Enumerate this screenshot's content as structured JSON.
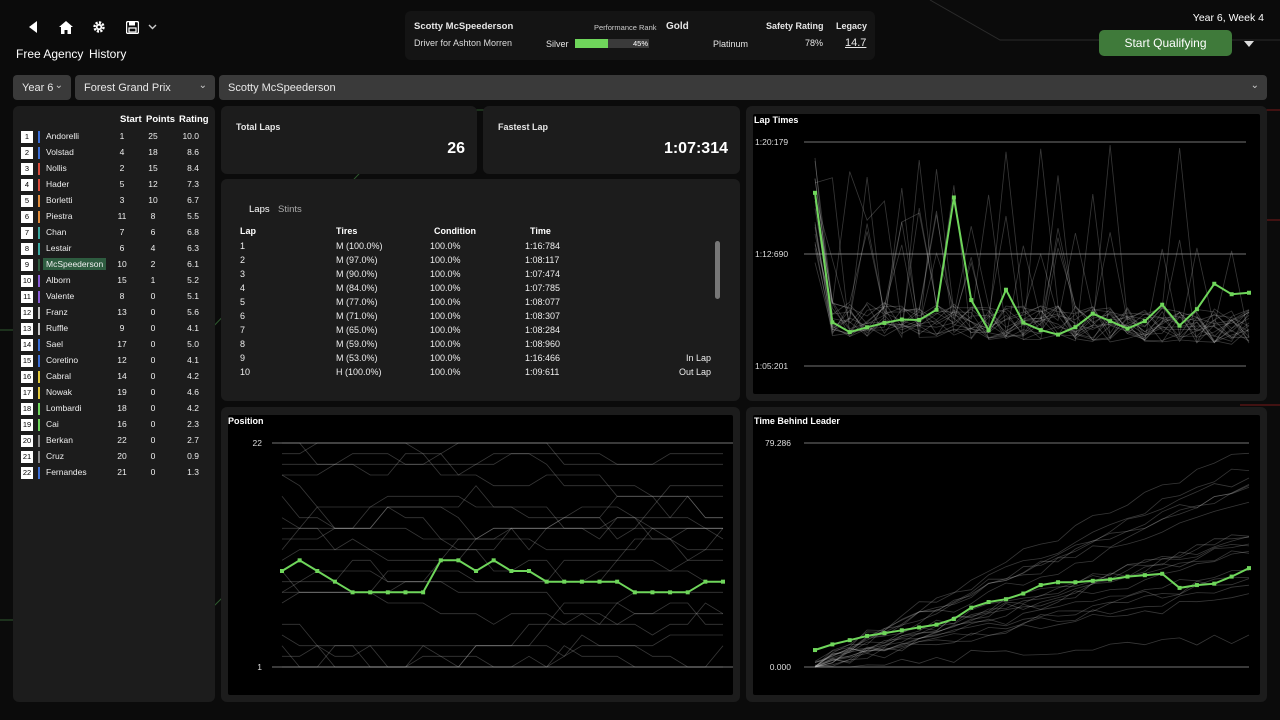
{
  "colors": {
    "accent": "#6fd65b",
    "button_green": "#3f7a3a",
    "panel": "#1c1c1c"
  },
  "topbar": {
    "icons": [
      "back-icon",
      "home-icon",
      "gear-icon",
      "save-icon",
      "chevron-down-icon"
    ],
    "nav": {
      "free_agency": "Free Agency",
      "history": "History"
    },
    "driver_name": "Scotty McSpeederson",
    "driver_for": "Driver for Ashton Morren",
    "performance_rank_label": "Performance Rank",
    "performance_rank_value": "Gold",
    "progress_left": "Silver",
    "progress_right": "Platinum",
    "progress_pct_text": "45%",
    "progress_value": 0.45,
    "safety_label": "Safety Rating",
    "safety_value": "78%",
    "legacy_label": "Legacy",
    "legacy_value": "14.7",
    "date": "Year 6, Week 4",
    "start_button": "Start Qualifying"
  },
  "filters": {
    "year": "Year 6",
    "race": "Forest Grand Prix",
    "driver": "Scotty McSpeederson"
  },
  "standings": {
    "headers": {
      "start": "Start",
      "points": "Points",
      "rating": "Rating"
    },
    "rows": [
      {
        "pos": "1",
        "name": "Andorelli",
        "start": "1",
        "points": "25",
        "rating": "10.0",
        "color": "#3a6ed8"
      },
      {
        "pos": "2",
        "name": "Volstad",
        "start": "4",
        "points": "18",
        "rating": "8.6",
        "color": "#3a6ed8"
      },
      {
        "pos": "3",
        "name": "Nollis",
        "start": "2",
        "points": "15",
        "rating": "8.4",
        "color": "#d84a3a"
      },
      {
        "pos": "4",
        "name": "Hader",
        "start": "5",
        "points": "12",
        "rating": "7.3",
        "color": "#d84a3a"
      },
      {
        "pos": "5",
        "name": "Borletti",
        "start": "3",
        "points": "10",
        "rating": "6.7",
        "color": "#e08a3a"
      },
      {
        "pos": "6",
        "name": "Piestra",
        "start": "11",
        "points": "8",
        "rating": "5.5",
        "color": "#e08a3a"
      },
      {
        "pos": "7",
        "name": "Chan",
        "start": "7",
        "points": "6",
        "rating": "6.8",
        "color": "#3aa8a0"
      },
      {
        "pos": "8",
        "name": "Lestair",
        "start": "6",
        "points": "4",
        "rating": "6.3",
        "color": "#3aa8a0"
      },
      {
        "pos": "9",
        "name": "McSpeederson",
        "start": "10",
        "points": "2",
        "rating": "6.1",
        "color": "#2e5c40"
      },
      {
        "pos": "10",
        "name": "Alborn",
        "start": "15",
        "points": "1",
        "rating": "5.2",
        "color": "#8a5ad8"
      },
      {
        "pos": "11",
        "name": "Valente",
        "start": "8",
        "points": "0",
        "rating": "5.1",
        "color": "#8a5ad8"
      },
      {
        "pos": "12",
        "name": "Franz",
        "start": "13",
        "points": "0",
        "rating": "5.6",
        "color": "#c8c8c8"
      },
      {
        "pos": "13",
        "name": "Ruffle",
        "start": "9",
        "points": "0",
        "rating": "4.1",
        "color": "#c8c8c8"
      },
      {
        "pos": "14",
        "name": "Sael",
        "start": "17",
        "points": "0",
        "rating": "5.0",
        "color": "#3a6ed8"
      },
      {
        "pos": "15",
        "name": "Coretino",
        "start": "12",
        "points": "0",
        "rating": "4.1",
        "color": "#3a6ed8"
      },
      {
        "pos": "16",
        "name": "Cabral",
        "start": "14",
        "points": "0",
        "rating": "4.2",
        "color": "#e0c83a"
      },
      {
        "pos": "17",
        "name": "Nowak",
        "start": "19",
        "points": "0",
        "rating": "4.6",
        "color": "#e0c83a"
      },
      {
        "pos": "18",
        "name": "Lombardi",
        "start": "18",
        "points": "0",
        "rating": "4.2",
        "color": "#6fd65b"
      },
      {
        "pos": "19",
        "name": "Cai",
        "start": "16",
        "points": "0",
        "rating": "2.3",
        "color": "#6fd65b"
      },
      {
        "pos": "20",
        "name": "Berkan",
        "start": "22",
        "points": "0",
        "rating": "2.7",
        "color": "#888888"
      },
      {
        "pos": "21",
        "name": "Cruz",
        "start": "20",
        "points": "0",
        "rating": "0.9",
        "color": "#888888"
      },
      {
        "pos": "22",
        "name": "Fernandes",
        "start": "21",
        "points": "0",
        "rating": "1.3",
        "color": "#3a6ed8"
      }
    ]
  },
  "stats": {
    "total_laps_label": "Total Laps",
    "total_laps": "26",
    "fastest_lap_label": "Fastest Lap",
    "fastest_lap": "1:07:314"
  },
  "laps": {
    "tabs": [
      "Laps",
      "Stints"
    ],
    "headers": {
      "lap": "Lap",
      "tires": "Tires",
      "condition": "Condition",
      "time": "Time"
    },
    "rows": [
      {
        "lap": "1",
        "tires": "M (100.0%)",
        "condition": "100.0%",
        "time": "1:16:784",
        "note": ""
      },
      {
        "lap": "2",
        "tires": "M (97.0%)",
        "condition": "100.0%",
        "time": "1:08:117",
        "note": ""
      },
      {
        "lap": "3",
        "tires": "M (90.0%)",
        "condition": "100.0%",
        "time": "1:07:474",
        "note": ""
      },
      {
        "lap": "4",
        "tires": "M (84.0%)",
        "condition": "100.0%",
        "time": "1:07:785",
        "note": ""
      },
      {
        "lap": "5",
        "tires": "M (77.0%)",
        "condition": "100.0%",
        "time": "1:08:077",
        "note": ""
      },
      {
        "lap": "6",
        "tires": "M (71.0%)",
        "condition": "100.0%",
        "time": "1:08:307",
        "note": ""
      },
      {
        "lap": "7",
        "tires": "M (65.0%)",
        "condition": "100.0%",
        "time": "1:08:284",
        "note": ""
      },
      {
        "lap": "8",
        "tires": "M (59.0%)",
        "condition": "100.0%",
        "time": "1:08:960",
        "note": ""
      },
      {
        "lap": "9",
        "tires": "M (53.0%)",
        "condition": "100.0%",
        "time": "1:16:466",
        "note": "In Lap"
      },
      {
        "lap": "10",
        "tires": "H (100.0%)",
        "condition": "100.0%",
        "time": "1:09:611",
        "note": "Out Lap"
      }
    ]
  },
  "chart_data": [
    {
      "type": "line",
      "title": "Lap Times",
      "ytick_labels": [
        "1:20:179",
        "1:12:690",
        "1:05:201"
      ],
      "ylim": [
        65.201,
        80.179
      ],
      "x": [
        1,
        2,
        3,
        4,
        5,
        6,
        7,
        8,
        9,
        10,
        11,
        12,
        13,
        14,
        15,
        16,
        17,
        18,
        19,
        20,
        21,
        22,
        23,
        24,
        25,
        26
      ],
      "series": [
        {
          "values": [
            76.78,
            68.12,
            67.47,
            67.79,
            68.08,
            68.31,
            68.28,
            68.96,
            76.47,
            69.61,
            67.6,
            70.3,
            68.1,
            67.6,
            67.3,
            67.8,
            68.7,
            68.2,
            67.7,
            68.2,
            69.3,
            67.9,
            69.0,
            70.7,
            70.0,
            70.1
          ]
        }
      ]
    },
    {
      "type": "line",
      "title": "Position",
      "ytick_labels": [
        "22",
        "1"
      ],
      "ylim": [
        1,
        22
      ],
      "x": [
        1,
        2,
        3,
        4,
        5,
        6,
        7,
        8,
        9,
        10,
        11,
        12,
        13,
        14,
        15,
        16,
        17,
        18,
        19,
        20,
        21,
        22,
        23,
        24,
        25,
        26
      ],
      "series": [
        {
          "values": [
            10,
            11,
            10,
            9,
            8,
            8,
            8,
            8,
            8,
            11,
            11,
            10,
            11,
            10,
            10,
            9,
            9,
            9,
            9,
            9,
            8,
            8,
            8,
            8,
            9,
            9
          ]
        }
      ]
    },
    {
      "type": "line",
      "title": "Time Behind Leader",
      "ytick_labels": [
        "79.286",
        "0.000"
      ],
      "ylim": [
        0,
        79.286
      ],
      "x": [
        1,
        2,
        3,
        4,
        5,
        6,
        7,
        8,
        9,
        10,
        11,
        12,
        13,
        14,
        15,
        16,
        17,
        18,
        19,
        20,
        21,
        22,
        23,
        24,
        25,
        26
      ],
      "series": [
        {
          "values": [
            6.0,
            8.0,
            9.5,
            11.0,
            12.0,
            13.0,
            14.0,
            15.0,
            17.0,
            21.0,
            23.0,
            24.0,
            26.0,
            29.0,
            30.0,
            30.0,
            30.5,
            31.0,
            32.0,
            32.5,
            33.0,
            28.0,
            29.0,
            29.5,
            32.0,
            35.0
          ]
        }
      ]
    }
  ]
}
